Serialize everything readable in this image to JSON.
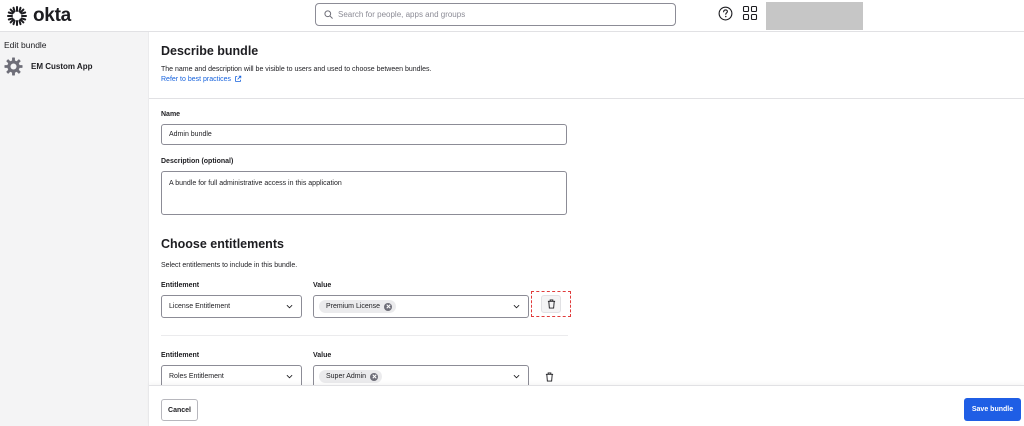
{
  "topbar": {
    "logo_text": "okta",
    "search_placeholder": "Search for people, apps and groups"
  },
  "sidebar": {
    "title": "Edit bundle",
    "app_name": "EM Custom App"
  },
  "describe": {
    "heading": "Describe bundle",
    "description": "The name and description will be visible to users and used to choose between bundles.",
    "link": "Refer to best practices",
    "name_label": "Name",
    "name_value": "Admin bundle",
    "desc_label": "Description (optional)",
    "desc_value": "A bundle for full administrative access in this application"
  },
  "entitlements": {
    "heading": "Choose entitlements",
    "subtitle": "Select entitlements to include in this bundle.",
    "rows": [
      {
        "entitlement_label": "Entitlement",
        "value_label": "Value",
        "entitlement": "License Entitlement",
        "value_chip": "Premium License"
      },
      {
        "entitlement_label": "Entitlement",
        "value_label": "Value",
        "entitlement": "Roles Entitlement",
        "value_chip": "Super Admin"
      }
    ]
  },
  "footer": {
    "cancel_label": "Cancel",
    "save_label": "Save bundle"
  },
  "colors": {
    "accent": "#1f5ee5",
    "link": "#1662dd",
    "highlight": "#e03c3c"
  }
}
